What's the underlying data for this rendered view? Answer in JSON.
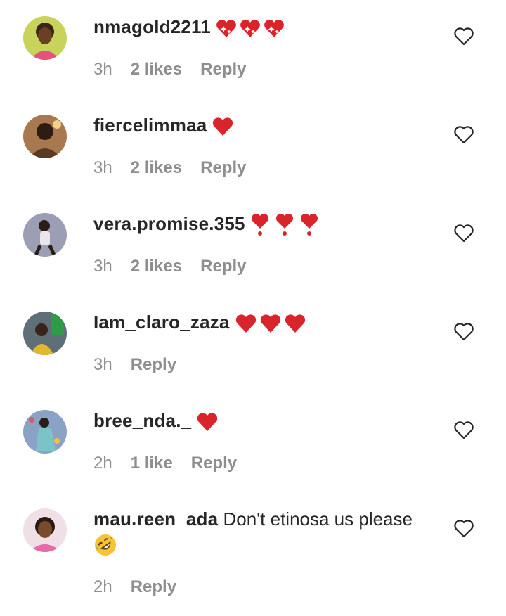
{
  "comments": [
    {
      "username": "nmagold2211",
      "text": "",
      "emoji": [
        "sparkle-heart",
        "sparkle-heart",
        "sparkle-heart"
      ],
      "time": "3h",
      "likes": "2 likes",
      "reply": "Reply"
    },
    {
      "username": "fiercelimmaa",
      "text": "",
      "emoji": [
        "red-heart"
      ],
      "time": "3h",
      "likes": "2 likes",
      "reply": "Reply"
    },
    {
      "username": "vera.promise.355",
      "text": "",
      "emoji": [
        "heart-exclamation",
        "heart-exclamation",
        "heart-exclamation"
      ],
      "time": "3h",
      "likes": "2 likes",
      "reply": "Reply"
    },
    {
      "username": "Iam_claro_zaza",
      "text": "",
      "emoji": [
        "red-heart",
        "red-heart",
        "red-heart"
      ],
      "time": "3h",
      "likes": "",
      "reply": "Reply"
    },
    {
      "username": "bree_nda._",
      "text": "",
      "emoji": [
        "red-heart"
      ],
      "time": "2h",
      "likes": "1 like",
      "reply": "Reply"
    },
    {
      "username": "mau.reen_ada",
      "text": "Don't etinosa us please",
      "emoji": [
        "rolling-laughing-face"
      ],
      "time": "2h",
      "likes": "",
      "reply": "Reply"
    }
  ],
  "colors": {
    "text": "#262626",
    "meta": "#8e8e8e",
    "heart_emoji": "#d9242b",
    "background": "#ffffff"
  },
  "icons": {
    "like": "heart-outline-icon"
  }
}
